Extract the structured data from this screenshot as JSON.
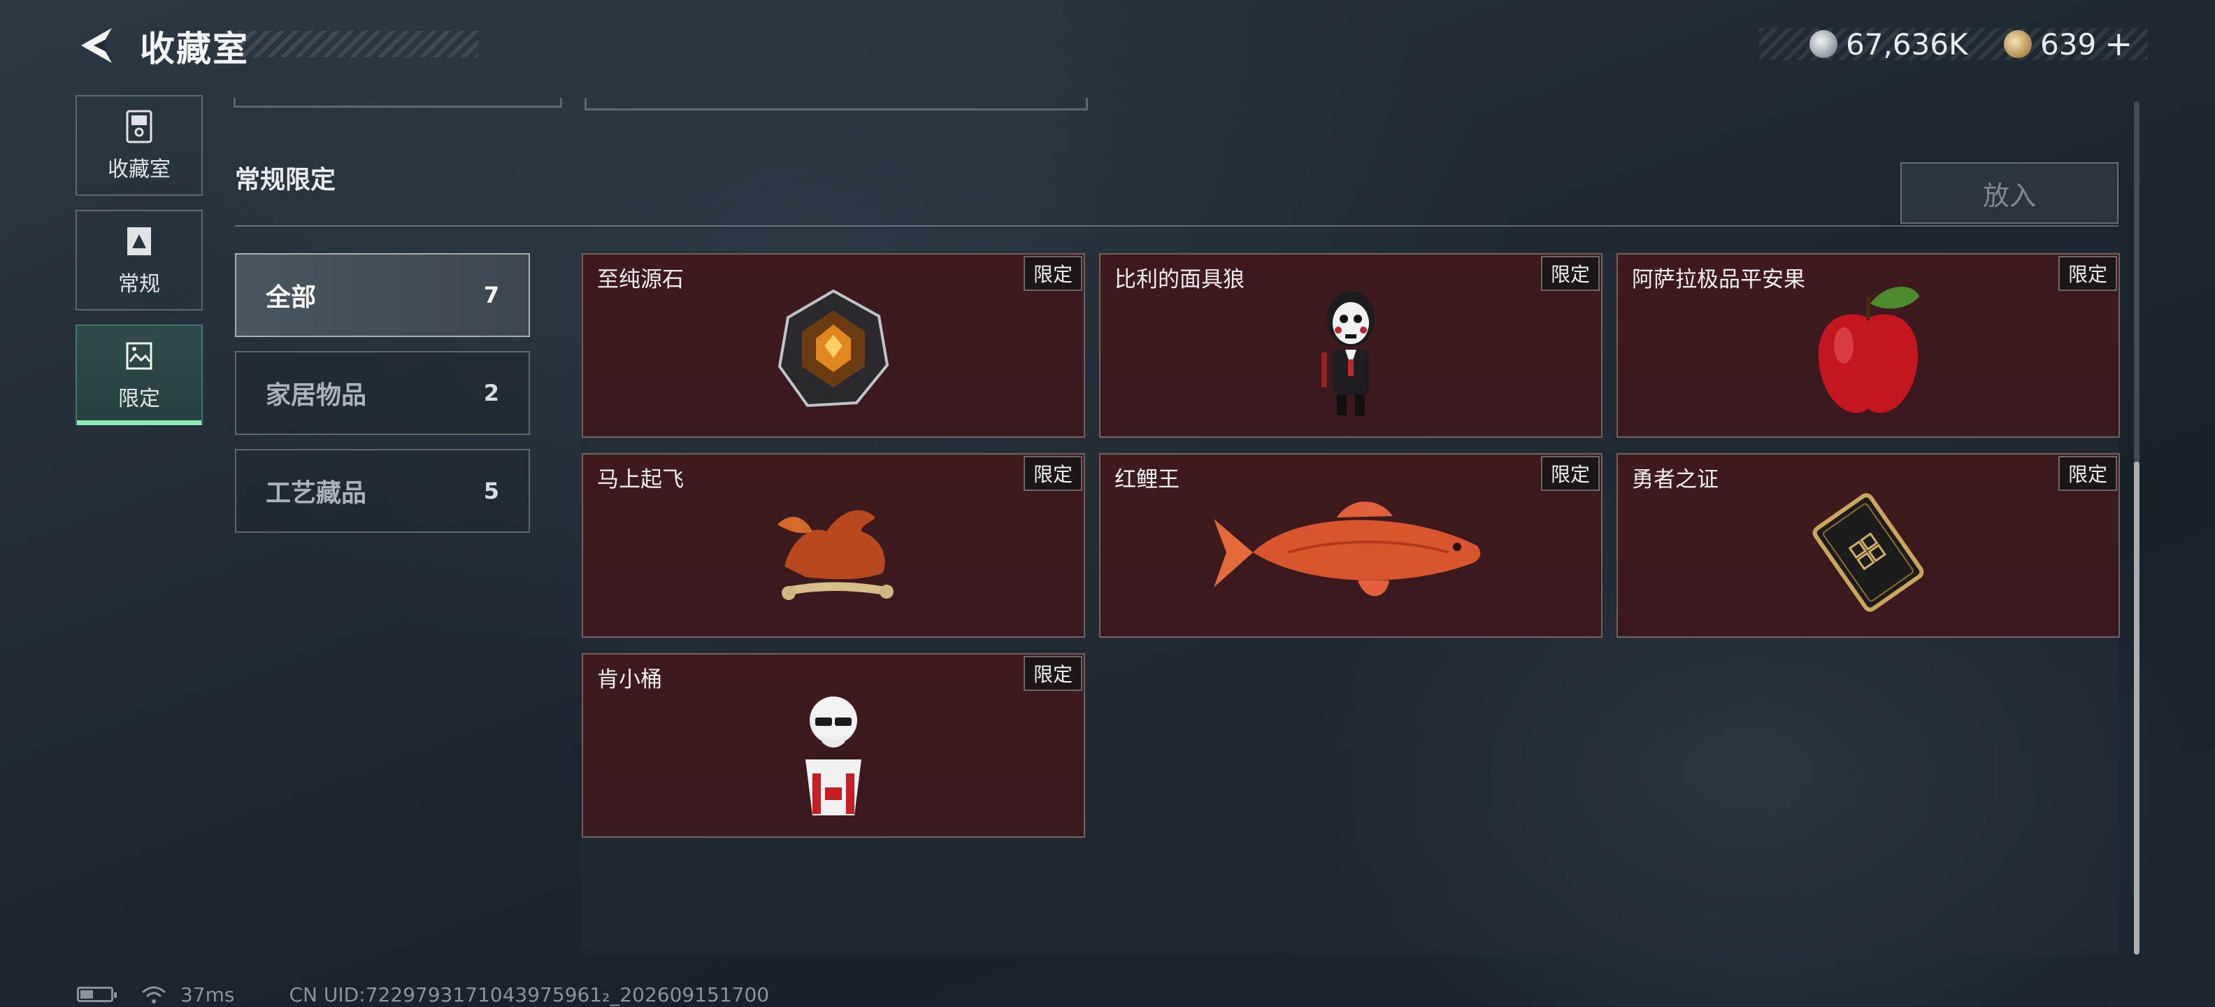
{
  "header": {
    "title": "收藏室",
    "currency": [
      {
        "icon": "silver-coin-icon",
        "value": "67,636K"
      },
      {
        "icon": "gold-coin-icon",
        "value": "639"
      }
    ],
    "add_symbol": "+"
  },
  "nav": [
    {
      "label": "收藏室",
      "icon": "collection-room-icon",
      "active": false
    },
    {
      "label": "常规",
      "icon": "regular-icon",
      "active": false
    },
    {
      "label": "限定",
      "icon": "limited-icon",
      "active": true
    }
  ],
  "section": {
    "title": "常规限定",
    "put_button": "放入"
  },
  "filters": [
    {
      "name": "全部",
      "count": "7",
      "active": true
    },
    {
      "name": "家居物品",
      "count": "2",
      "active": false
    },
    {
      "name": "工艺藏品",
      "count": "5",
      "active": false
    }
  ],
  "items": [
    {
      "name": "至纯源石",
      "badge": "限定",
      "icon": "pure-origin-stone-icon"
    },
    {
      "name": "比利的面具狼",
      "badge": "限定",
      "icon": "billy-puppet-icon"
    },
    {
      "name": "阿萨拉极品平安果",
      "badge": "限定",
      "icon": "apple-icon"
    },
    {
      "name": "马上起飞",
      "badge": "限定",
      "icon": "horse-sculpture-icon"
    },
    {
      "name": "红鲤王",
      "badge": "限定",
      "icon": "red-carp-icon"
    },
    {
      "name": "勇者之证",
      "badge": "限定",
      "icon": "brave-card-icon"
    },
    {
      "name": "肯小桶",
      "badge": "限定",
      "icon": "kfc-figure-icon"
    }
  ],
  "footer": {
    "ping": "37ms",
    "uid": "CN UID:7229793171043975961₂_202609151700"
  },
  "colors": {
    "card_bg": "#3e1a1e",
    "active_nav_accent": "#8ee6b2"
  }
}
